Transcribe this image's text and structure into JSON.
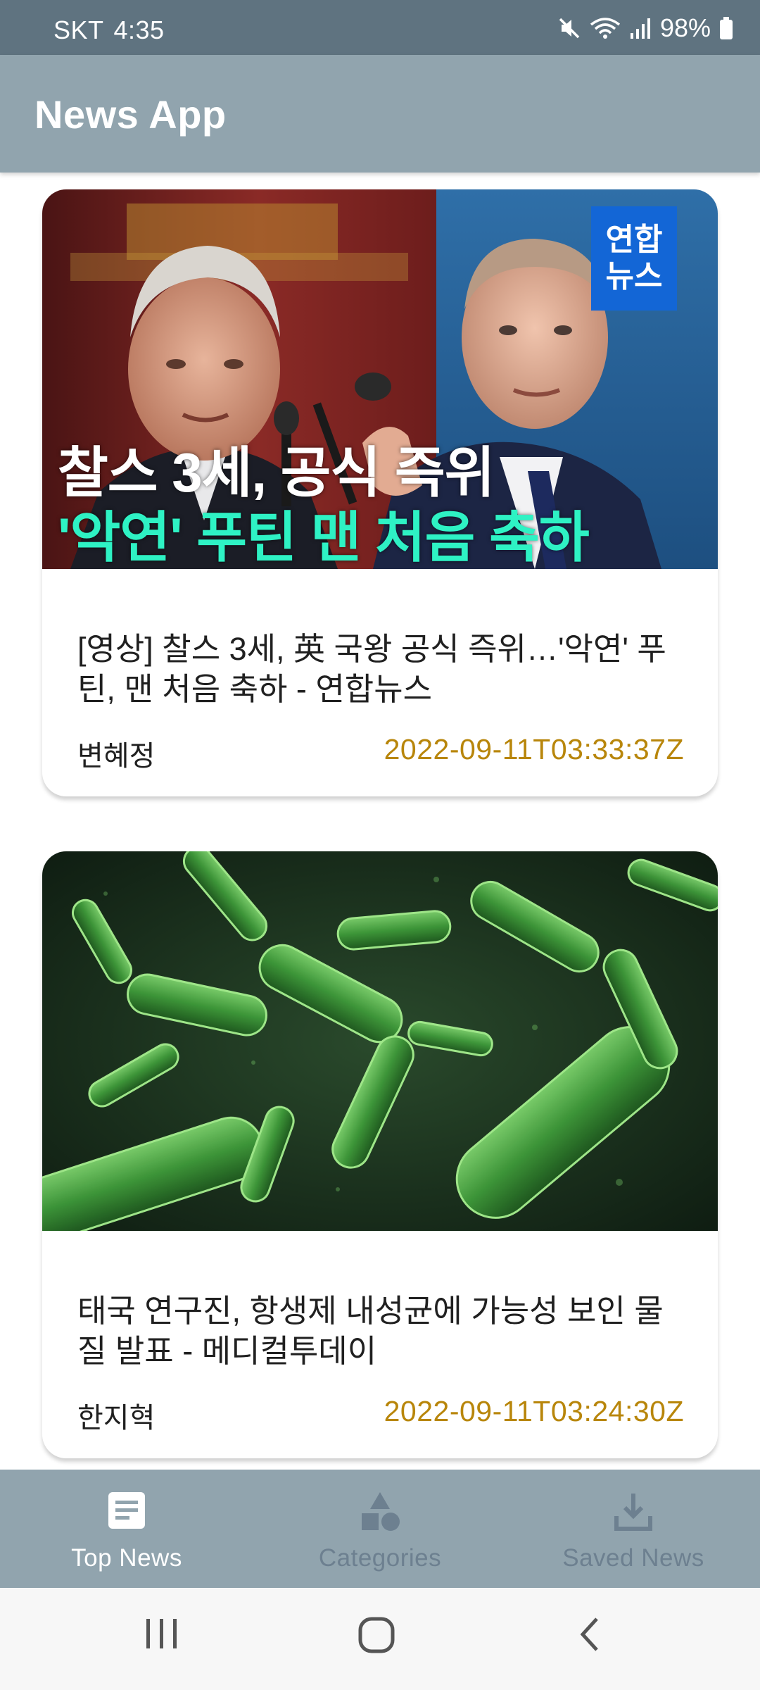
{
  "status_bar": {
    "carrier": "SKT",
    "time": "4:35",
    "battery": "98%"
  },
  "app_bar": {
    "title": "News App"
  },
  "articles": [
    {
      "thumbnail": {
        "overlay_line_1": "찰스 3세, 공식 즉위",
        "overlay_line_2": "'악연' 푸틴 맨 처음 축하",
        "logo_line_1": "연합",
        "logo_line_2": "뉴스"
      },
      "title": "[영상] 찰스 3세, 英 국왕 공식 즉위…'악연' 푸틴, 맨 처음 축하 - 연합뉴스",
      "author": "변혜정",
      "published_at": "2022-09-11T03:33:37Z"
    },
    {
      "title": "태국 연구진, 항생제 내성균에 가능성 보인 물질 발표 - 메디컬투데이",
      "author": "한지혁",
      "published_at": "2022-09-11T03:24:30Z"
    }
  ],
  "bottom_nav": {
    "items": [
      {
        "label": "Top News",
        "icon": "article-icon",
        "selected": true
      },
      {
        "label": "Categories",
        "icon": "category-shapes-icon",
        "selected": false
      },
      {
        "label": "Saved News",
        "icon": "download-icon",
        "selected": false
      }
    ]
  },
  "system_nav": {
    "buttons": [
      "recents-icon",
      "home-icon",
      "back-icon"
    ]
  },
  "colors": {
    "status_bar": "#5f7380",
    "app_bar": "#91a4ae",
    "date_text": "#b8860b",
    "nav_active": "#ffffff",
    "nav_inactive": "#6d8090"
  }
}
